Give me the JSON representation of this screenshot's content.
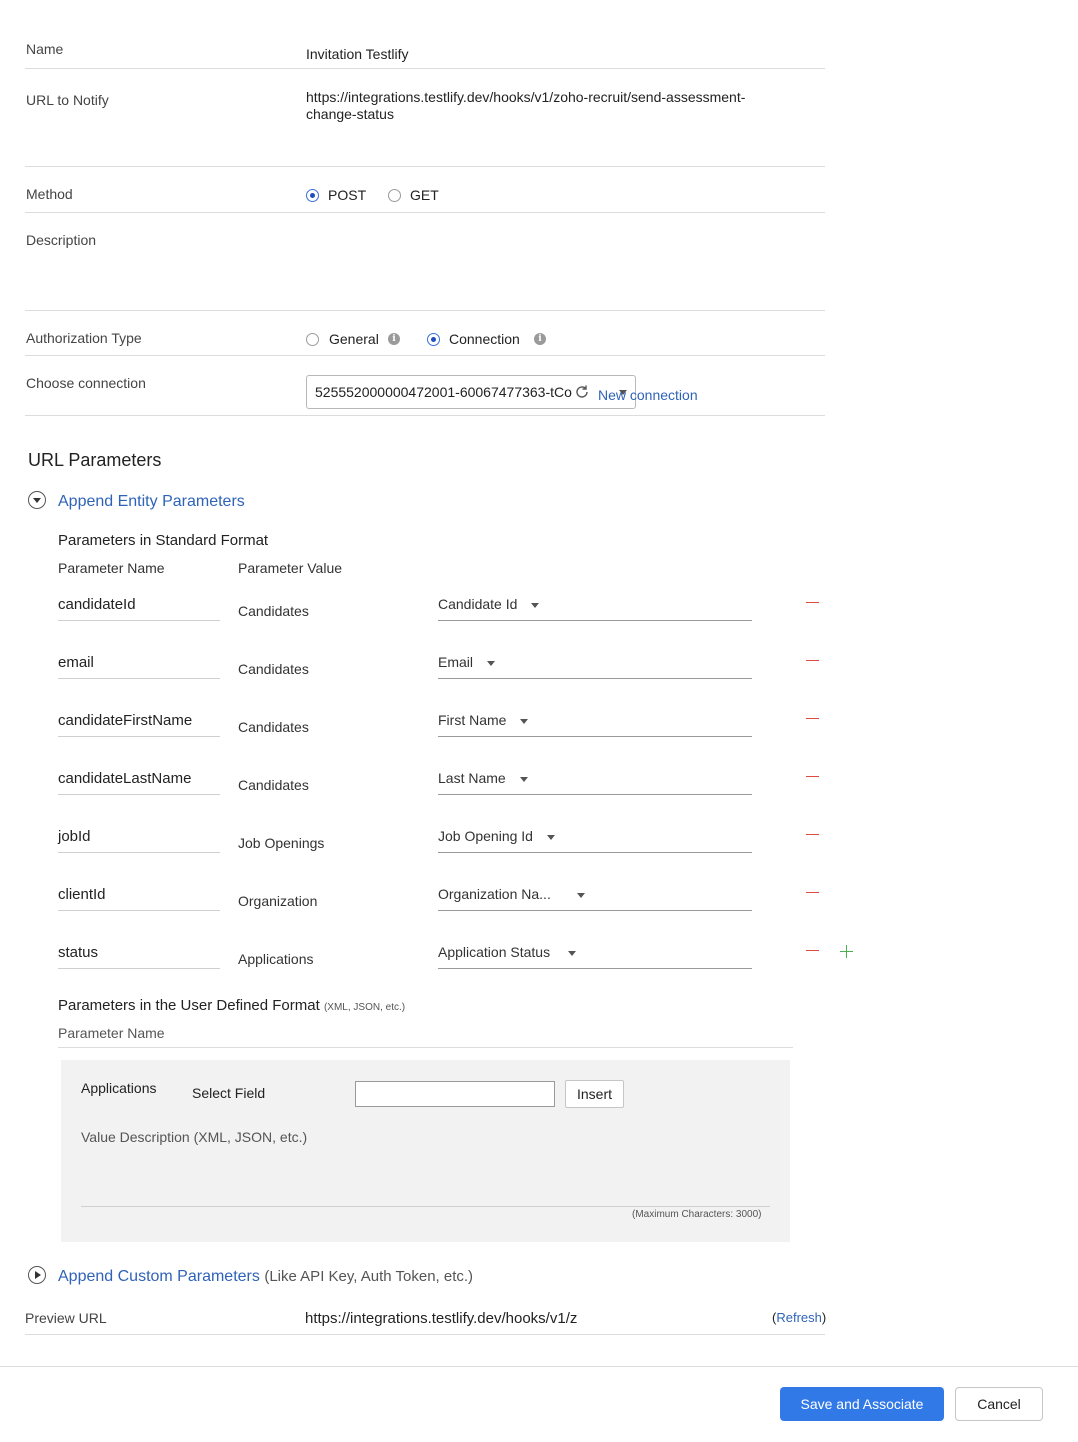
{
  "form": {
    "name_label": "Name",
    "name_value": "Invitation Testlify",
    "url_label": "URL to Notify",
    "url_line1": "https://integrations.testlify.dev/hooks/v1/zoho-recruit/send-assessment-",
    "url_line2": "change-status",
    "method_label": "Method",
    "method_options": [
      "POST",
      "GET"
    ],
    "method_selected": "POST",
    "description_label": "Description",
    "auth_label": "Authorization Type",
    "auth_options": [
      "General",
      "Connection"
    ],
    "auth_selected": "Connection",
    "connection_label": "Choose connection",
    "connection_value": "525552000000472001-60067477363-tCo",
    "new_connection": "New connection"
  },
  "url_params": {
    "title": "URL Parameters",
    "append_entity": "Append Entity Parameters",
    "standard_title": "Parameters in Standard Format",
    "col_name": "Parameter Name",
    "col_value": "Parameter Value",
    "rows": [
      {
        "name": "candidateId",
        "module": "Candidates",
        "field": "Candidate Id"
      },
      {
        "name": "email",
        "module": "Candidates",
        "field": "Email"
      },
      {
        "name": "candidateFirstName",
        "module": "Candidates",
        "field": "First Name"
      },
      {
        "name": "candidateLastName",
        "module": "Candidates",
        "field": "Last Name"
      },
      {
        "name": "jobId",
        "module": "Job Openings",
        "field": "Job Opening Id"
      },
      {
        "name": "clientId",
        "module": "Organization",
        "field": "Organization Na..."
      },
      {
        "name": "status",
        "module": "Applications",
        "field": "Application Status"
      }
    ],
    "user_defined_title": "Parameters in the User Defined Format",
    "user_defined_hint": "(XML, JSON, etc.)",
    "user_defined_col": "Parameter Name",
    "panel_module": "Applications",
    "panel_select_field": "Select Field",
    "insert_button": "Insert",
    "value_description_placeholder": "Value Description (XML, JSON, etc.)",
    "max_chars": "(Maximum Characters: 3000)",
    "append_custom": "Append Custom Parameters",
    "append_custom_hint": "(Like API Key, Auth Token, etc.)",
    "preview_label": "Preview URL",
    "preview_value": "https://integrations.testlify.dev/hooks/v1/z",
    "refresh_open": "(",
    "refresh": "Refresh",
    "refresh_close": ")"
  },
  "footer": {
    "save_button": "Save and Associate",
    "cancel_button": "Cancel"
  },
  "colors": {
    "primary": "#3279e8",
    "link": "#2f63b8",
    "remove": "#e04a3f",
    "add": "#4caf50"
  }
}
